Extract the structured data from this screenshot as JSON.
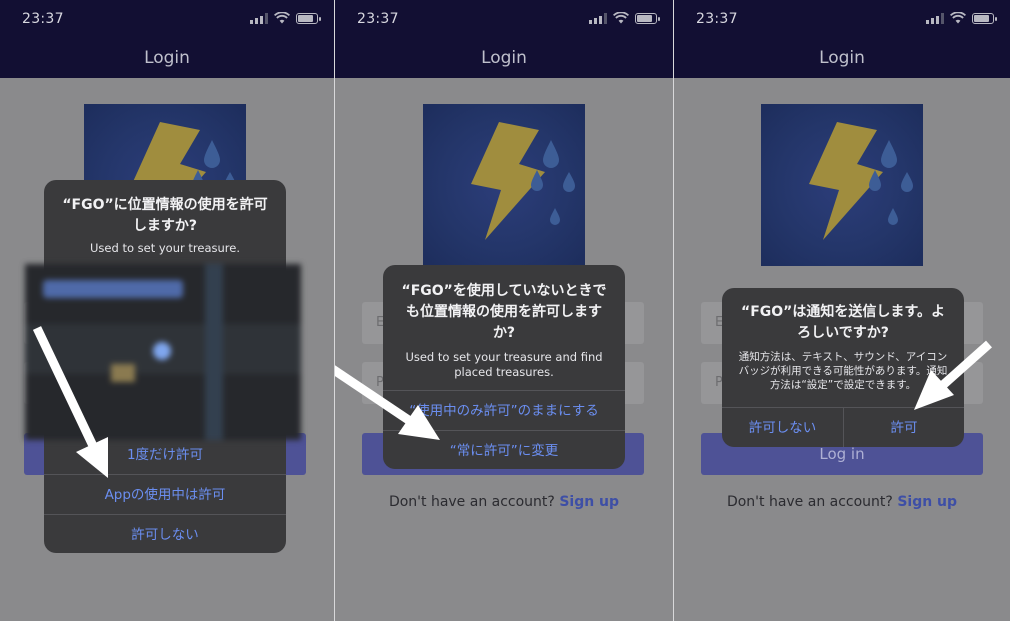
{
  "screens": [
    {
      "time": "23:37",
      "nav_title": "Login",
      "alert": {
        "title": "“FGO”に位置情報の使用を許可しますか?",
        "message": "Used to set your treasure.",
        "buttons": [
          "1度だけ許可",
          "Appの使用中は許可",
          "許可しない"
        ]
      }
    },
    {
      "time": "23:37",
      "nav_title": "Login",
      "email_placeholder": "E",
      "password_placeholder": "P",
      "signup_prompt": "Don't have an account?",
      "signup_link": "Sign up",
      "alert": {
        "title": "“FGO”を使用していないときでも位置情報の使用を許可しますか?",
        "message": "Used to set your treasure and find placed treasures.",
        "buttons": [
          "“使用中のみ許可”のままにする",
          "“常に許可”に変更"
        ]
      }
    },
    {
      "time": "23:37",
      "nav_title": "Login",
      "email_placeholder": "E",
      "password_placeholder": "P",
      "login_label": "Log in",
      "signup_prompt": "Don't have an account?",
      "signup_link": "Sign up",
      "alert": {
        "title": "“FGO”は通知を送信します。よろしいですか?",
        "message": "通知方法は、テキスト、サウンド、アイコンバッジが利用できる可能性があります。通知方法は“設定”で設定できます。",
        "buttons": [
          "許可しない",
          "許可"
        ]
      }
    }
  ],
  "colors": {
    "nav_bar": "#120f33",
    "dim_overlay": "#8a8a8c",
    "alert_bg": "#3a3a3c",
    "alert_button": "#6b8ef0",
    "login_button": "#4e5296",
    "signup_link": "#3e4fa6",
    "annotation_arrow": "#ffffff"
  },
  "icons": [
    "lightning-bolt-logo-icon",
    "raindrop-icon",
    "cellular-signal-icon",
    "wifi-icon",
    "battery-icon",
    "annotation-arrow"
  ]
}
